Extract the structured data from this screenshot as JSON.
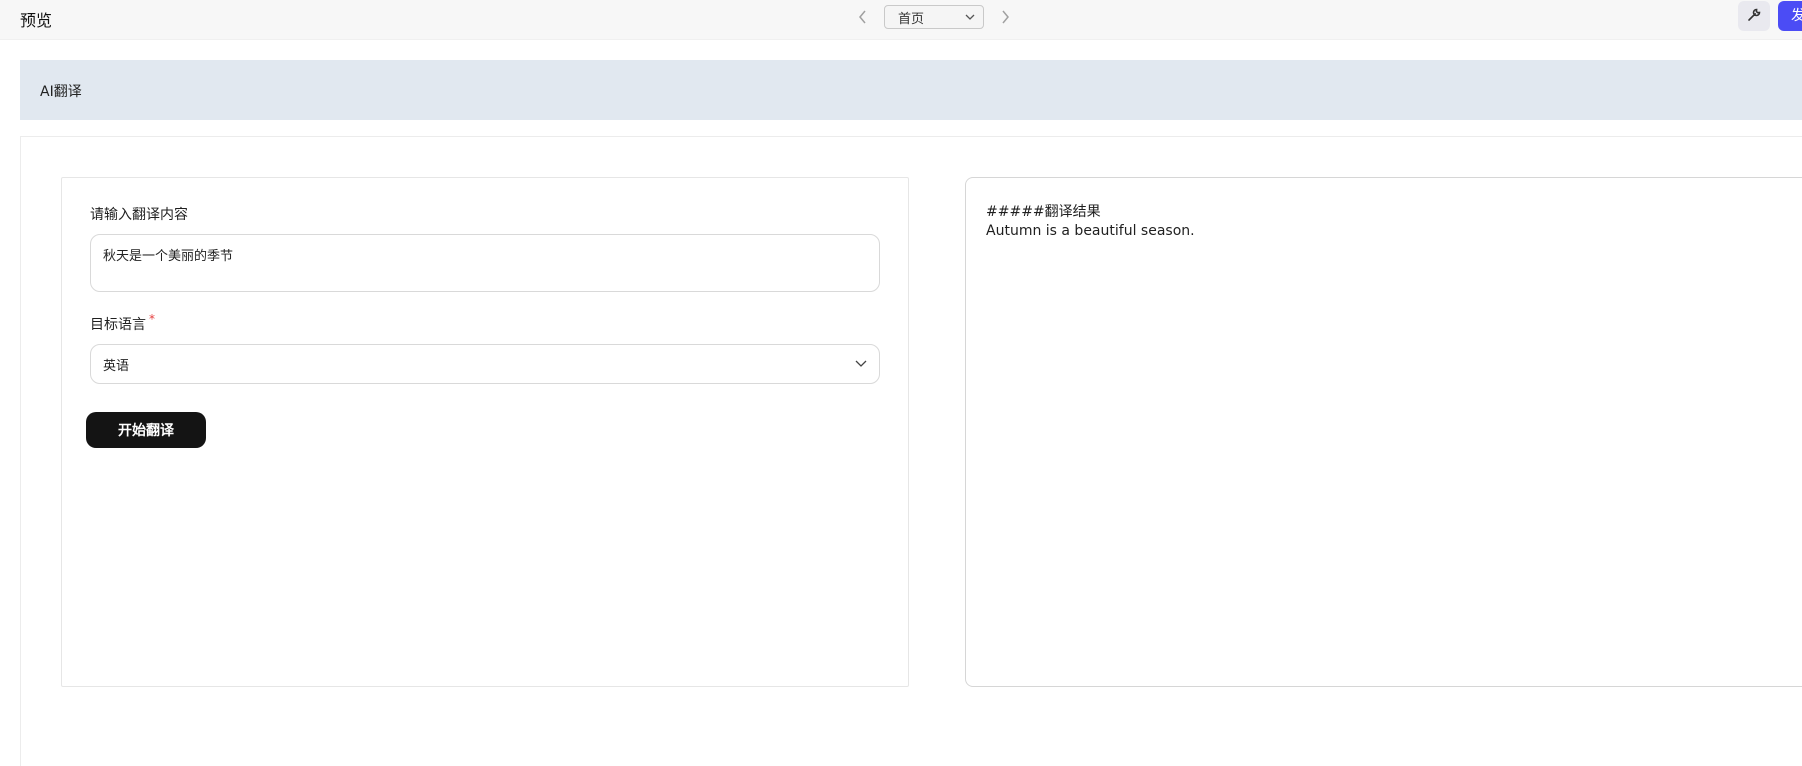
{
  "topbar": {
    "title": "预览",
    "pager": {
      "prev_icon": "chevron-left-icon",
      "selected_page": "首页",
      "dropdown_icon": "chevron-down-icon",
      "next_icon": "chevron-right-icon"
    },
    "tool_icon": "wrench-icon",
    "publish_label": "发"
  },
  "header": {
    "label": "AI翻译"
  },
  "form": {
    "input_label": "请输入翻译内容",
    "input_value": "秋天是一个美丽的季节",
    "language_label": "目标语言",
    "required_mark": "*",
    "language_value": "英语",
    "submit_label": "开始翻译"
  },
  "result": {
    "heading": "#####翻译结果",
    "text": "Autumn is a beautiful season."
  },
  "colors": {
    "accent": "#4b4cf5",
    "header_band": "#e1e8f0",
    "submit_button": "#141414"
  }
}
